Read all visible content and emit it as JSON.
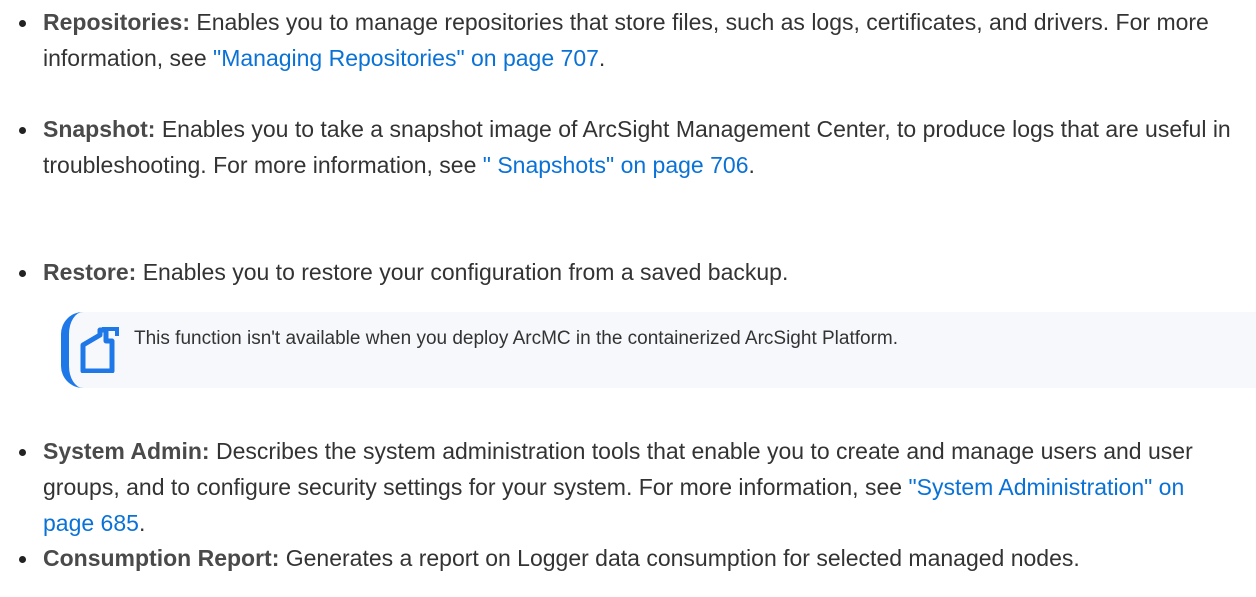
{
  "items": [
    {
      "term": "Repositories:",
      "text_before": " Enables you to manage repositories that store files, such as logs, certificates, and drivers. For more information, see ",
      "link": "\"Managing Repositories\" on page 707",
      "text_after": "."
    },
    {
      "term": "Snapshot:",
      "text_before": " Enables you to take a snapshot image of ArcSight Management Center, to produce logs that are useful in troubleshooting. For more information, see ",
      "link": "\" Snapshots\" on page 706",
      "text_after": "."
    },
    {
      "term": "Restore:",
      "text_before": " Enables you to restore your configuration from a saved backup.",
      "link": null,
      "text_after": ""
    },
    {
      "term": "System Admin:",
      "text_before": " Describes the system administration tools that enable you to create and manage users and user groups, and to configure security settings for your system. For more information, see ",
      "link": "\"System Administration\" on page 685",
      "text_after": "."
    },
    {
      "term": "Consumption Report:",
      "text_before": " Generates a report on Logger data consumption for selected managed nodes.",
      "link": null,
      "text_after": ""
    }
  ],
  "note": {
    "icon": "note-icon",
    "text": "This function isn't available when you deploy ArcMC in the containerized ArcSight Platform."
  },
  "colors": {
    "link": "#0a72d6",
    "note_border": "#1e78e8",
    "note_background": "#f6f8fb",
    "text": "#333333"
  }
}
